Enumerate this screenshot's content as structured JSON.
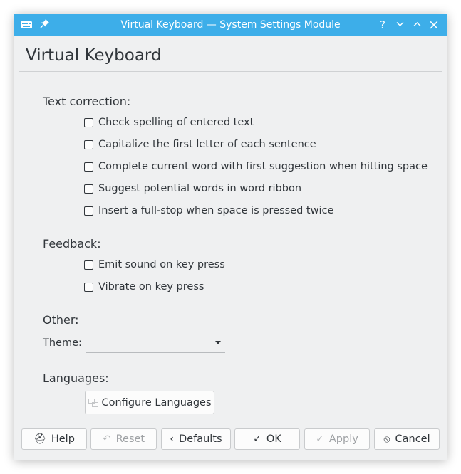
{
  "window": {
    "title": "Virtual Keyboard — System Settings Module",
    "app_icon": "keyboard-icon",
    "controls": {
      "pin": "pin-icon",
      "help": "?",
      "minimize": "chevron-down-icon",
      "maximize": "chevron-up-icon",
      "close": "×"
    }
  },
  "page": {
    "title": "Virtual Keyboard"
  },
  "text_correction": {
    "label": "Text correction:",
    "options": [
      {
        "label": "Check spelling of entered text",
        "checked": false
      },
      {
        "label": "Capitalize the first letter of each sentence",
        "checked": false
      },
      {
        "label": "Complete current word with first suggestion when hitting space",
        "checked": false
      },
      {
        "label": "Suggest potential words in word ribbon",
        "checked": false
      },
      {
        "label": "Insert a full-stop when space is pressed twice",
        "checked": false
      }
    ]
  },
  "feedback": {
    "label": "Feedback:",
    "options": [
      {
        "label": "Emit sound on key press",
        "checked": false
      },
      {
        "label": "Vibrate on key press",
        "checked": false
      }
    ]
  },
  "other": {
    "label": "Other:",
    "theme_label": "Theme:",
    "theme_value": ""
  },
  "languages": {
    "label": "Languages:",
    "configure_button": "Configure Languages"
  },
  "buttons": {
    "help": "Help",
    "reset": "Reset",
    "defaults": "Defaults",
    "ok": "OK",
    "apply": "Apply",
    "cancel": "Cancel"
  },
  "colors": {
    "titlebar": "#3daee9",
    "window_bg": "#eff0f1",
    "text": "#31363b",
    "disabled_text": "#9ea1a4"
  }
}
